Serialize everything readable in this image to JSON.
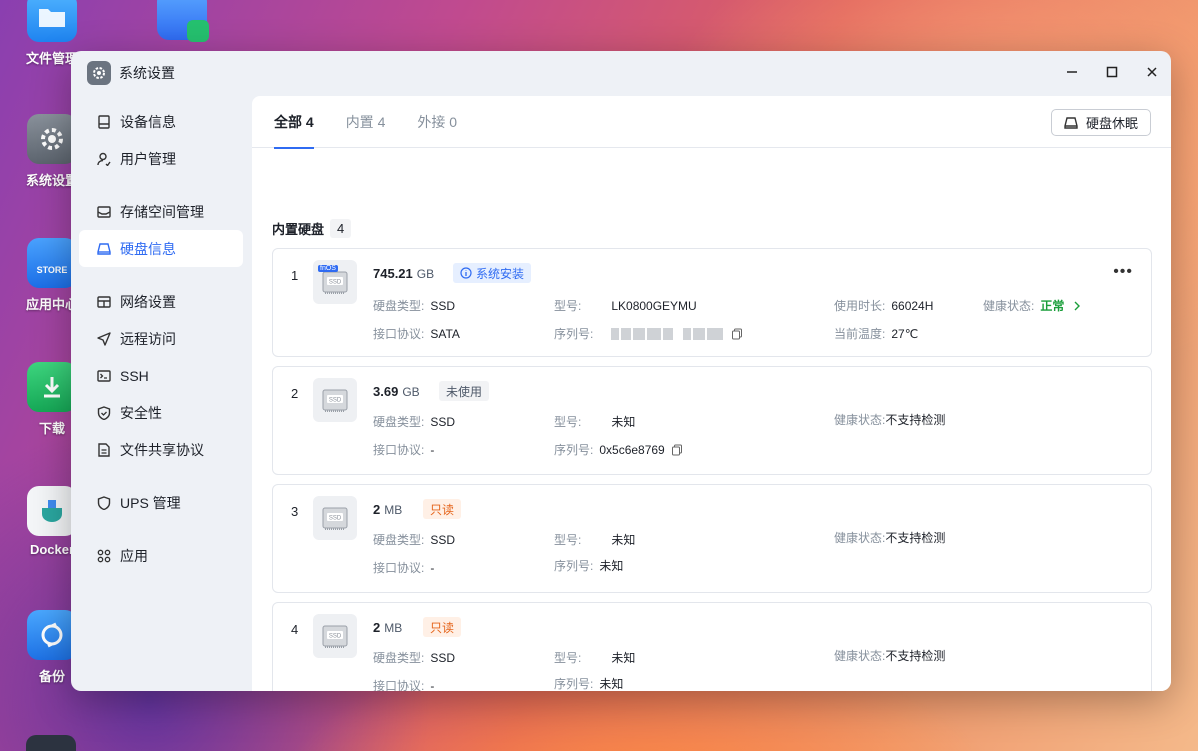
{
  "desktop": {
    "icons": [
      {
        "label": "文件管理",
        "icon": "folder-icon"
      },
      {
        "label": "系统设置",
        "icon": "gear-icon"
      },
      {
        "label": "应用中心",
        "icon": "store-icon",
        "tile_text": "STORE"
      },
      {
        "label": "下载",
        "icon": "download-icon"
      },
      {
        "label": "Docker",
        "icon": "docker-icon"
      },
      {
        "label": "备份",
        "icon": "backup-icon"
      }
    ]
  },
  "window": {
    "title": "系统设置",
    "controls": [
      "minimize",
      "maximize",
      "close"
    ]
  },
  "sidebar": {
    "items": [
      {
        "label": "设备信息",
        "icon": "device-icon"
      },
      {
        "label": "用户管理",
        "icon": "user-icon"
      },
      {
        "label": "存储空间管理",
        "icon": "storage-icon"
      },
      {
        "label": "硬盘信息",
        "icon": "disk-icon",
        "active": true
      },
      {
        "label": "网络设置",
        "icon": "network-icon"
      },
      {
        "label": "远程访问",
        "icon": "remote-icon"
      },
      {
        "label": "SSH",
        "icon": "ssh-icon"
      },
      {
        "label": "安全性",
        "icon": "shield-icon"
      },
      {
        "label": "文件共享协议",
        "icon": "file-share-icon"
      },
      {
        "label": "UPS 管理",
        "icon": "ups-icon"
      },
      {
        "label": "应用",
        "icon": "apps-icon"
      }
    ]
  },
  "tabs": [
    {
      "label": "全部 4",
      "active": true
    },
    {
      "label": "内置 4"
    },
    {
      "label": "外接 0"
    }
  ],
  "sleep_button": "硬盘休眠",
  "section": {
    "title": "内置硬盘",
    "count": "4"
  },
  "labels": {
    "disk_type": "硬盘类型:",
    "interface": "接口协议:",
    "model": "型号:",
    "serial": "序列号:",
    "uptime": "使用时长:",
    "temperature": "当前温度:",
    "health": "健康状态:"
  },
  "disks": [
    {
      "num": "1",
      "size": "745.21",
      "unit": "GB",
      "badge": "系统安装",
      "badge_type": "info",
      "icon_tag": "fnOS",
      "icon_text": "SSD",
      "disk_type": "SSD",
      "interface": "SATA",
      "model": "LK0800GEYMU",
      "serial": "",
      "uptime": "66024H",
      "temperature": "27℃",
      "health": "正常"
    },
    {
      "num": "2",
      "size": "3.69",
      "unit": "GB",
      "badge": "未使用",
      "badge_type": "gray",
      "icon_text": "SSD",
      "disk_type": "SSD",
      "interface": "-",
      "model": "未知",
      "serial": "0x5c6e8769",
      "health": "不支持检测"
    },
    {
      "num": "3",
      "size": "2",
      "unit": "MB",
      "badge": "只读",
      "badge_type": "warn",
      "icon_text": "SSD",
      "disk_type": "SSD",
      "interface": "-",
      "model": "未知",
      "serial": "未知",
      "health": "不支持检测"
    },
    {
      "num": "4",
      "size": "2",
      "unit": "MB",
      "badge": "只读",
      "badge_type": "warn",
      "icon_text": "SSD",
      "disk_type": "SSD",
      "interface": "-",
      "model": "未知",
      "serial": "未知",
      "health": "不支持检测"
    }
  ]
}
